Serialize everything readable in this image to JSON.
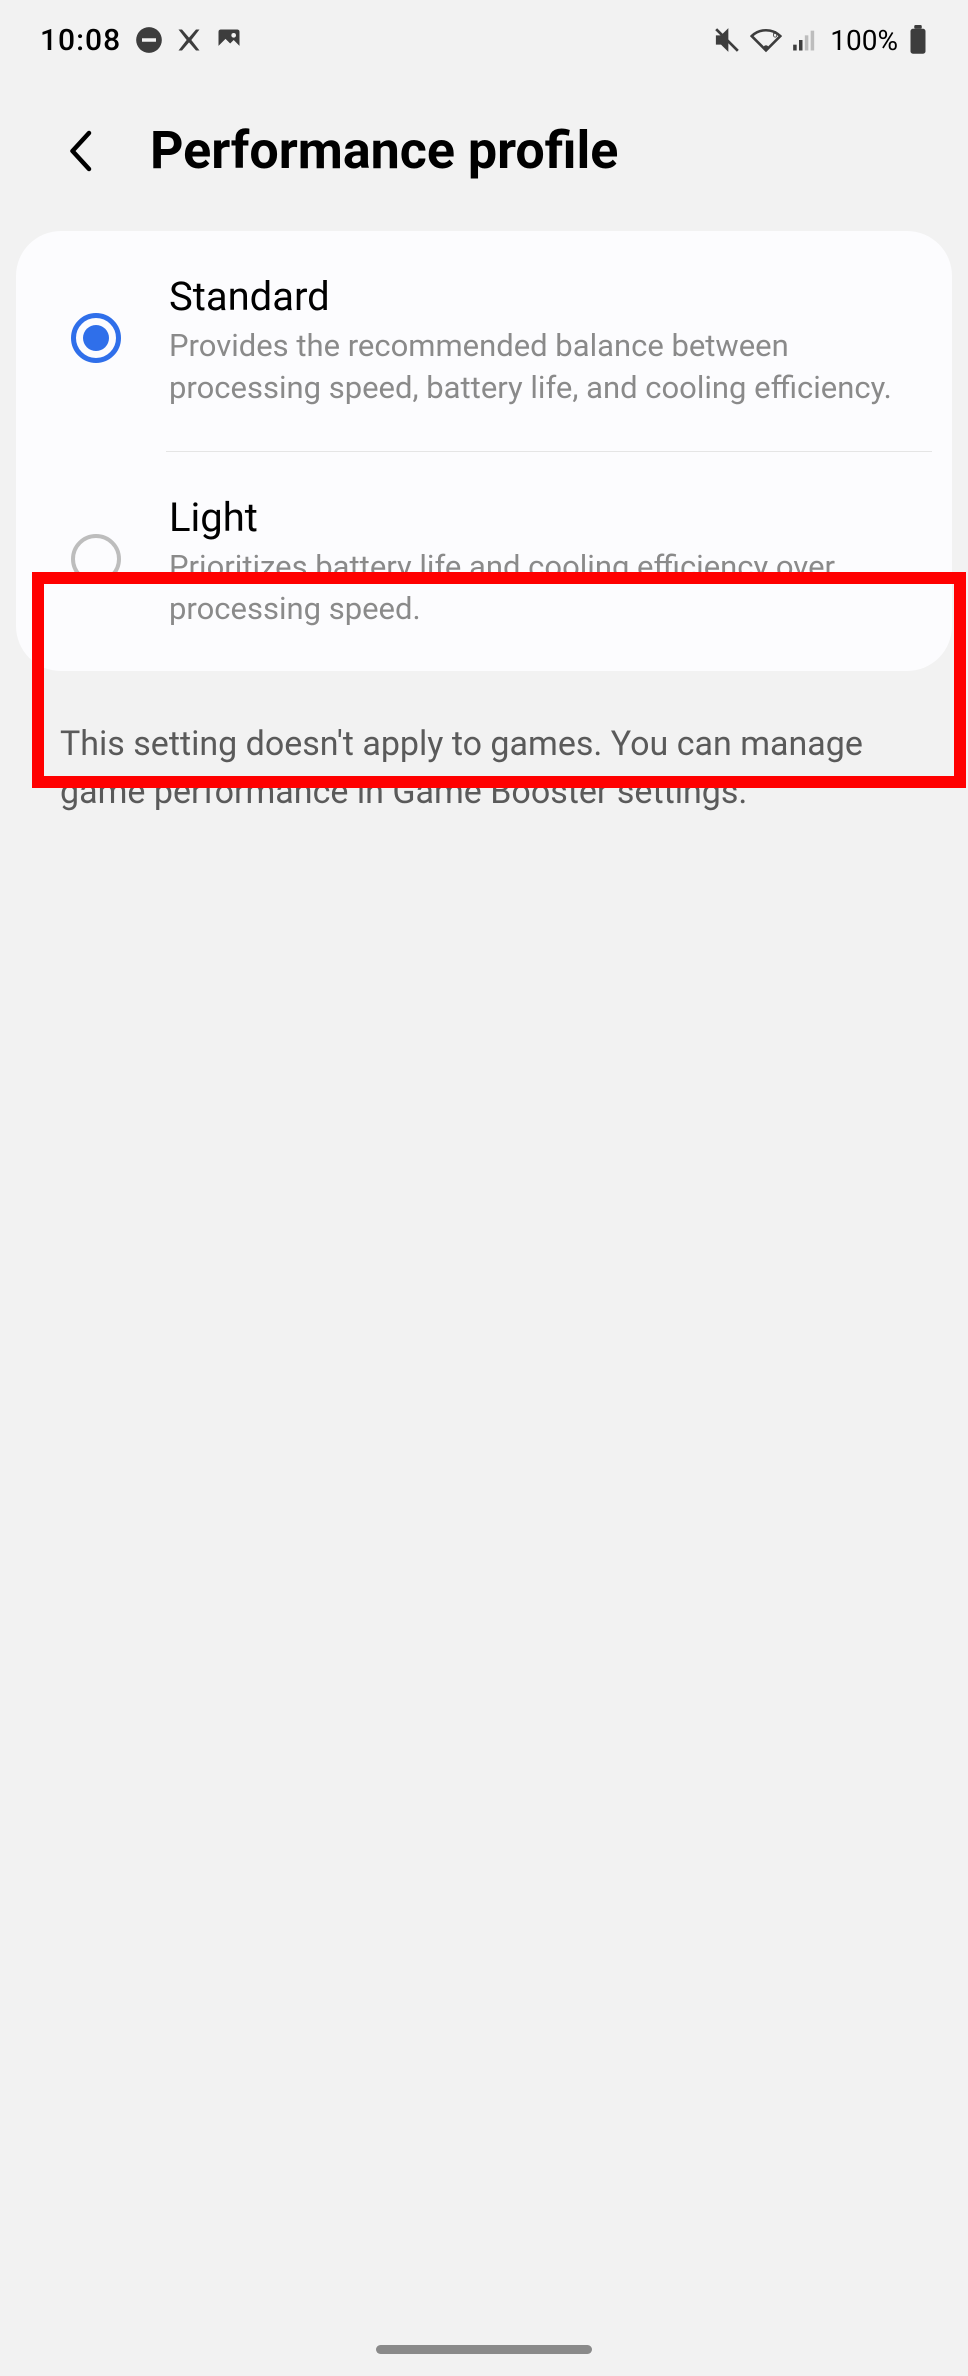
{
  "status": {
    "time": "10:08",
    "battery_pct": "100%"
  },
  "header": {
    "title": "Performance profile"
  },
  "options": [
    {
      "title": "Standard",
      "desc": "Provides the recommended balance between processing speed, battery life, and cooling efficiency.",
      "selected": true
    },
    {
      "title": "Light",
      "desc": "Prioritizes battery life and cooling efficiency over processing speed.",
      "selected": false
    }
  ],
  "footer_note": "This setting doesn't apply to games. You can manage game performance in Game Booster settings."
}
